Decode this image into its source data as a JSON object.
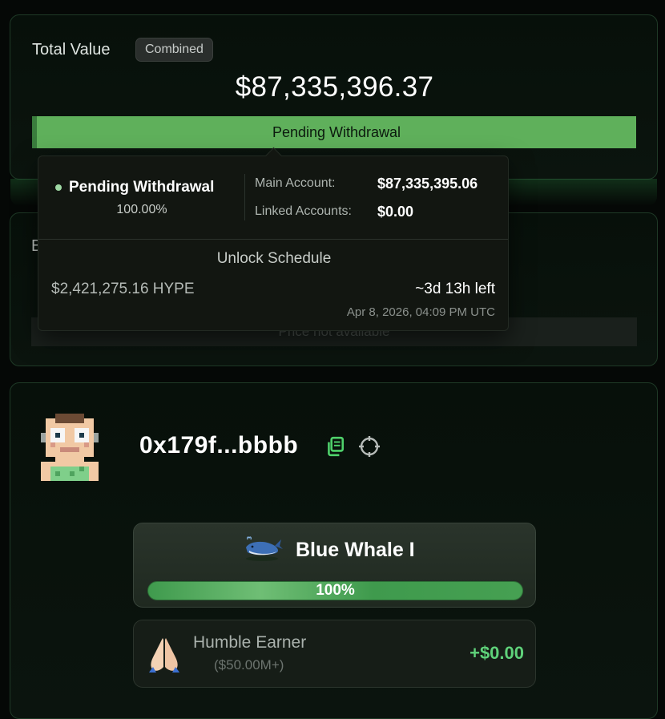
{
  "total": {
    "label": "Total Value",
    "badge": "Combined",
    "value": "$87,335,396.37",
    "bar_label": "Pending Withdrawal",
    "bar_fraction": 1.0
  },
  "breakdown": {
    "letter": "B",
    "price_text": "Price not available"
  },
  "tooltip": {
    "title": "Pending Withdrawal",
    "percent": "100.00%",
    "main_label": "Main Account:",
    "main_value": "$87,335,395.06",
    "linked_label": "Linked Accounts:",
    "linked_value": "$0.00",
    "unlock_title": "Unlock Schedule",
    "unlock_amount": "$2,421,275.16 HYPE",
    "unlock_left": "~3d 13h left",
    "unlock_date": "Apr 8, 2026, 04:09 PM UTC"
  },
  "profile": {
    "address": "0x179f...bbbb",
    "tier_name": "Blue Whale I",
    "tier_progress": "100%",
    "earner_name": "Humble Earner",
    "earner_threshold": "($50.00M+)",
    "earner_amount": "+$0.00"
  },
  "colors": {
    "accent_green": "#5fb05b",
    "positive_green": "#5fd27a"
  },
  "icons": [
    "copy-icon",
    "crosshair-icon",
    "whale-icon",
    "praying-hands-icon",
    "pixel-avatar"
  ]
}
